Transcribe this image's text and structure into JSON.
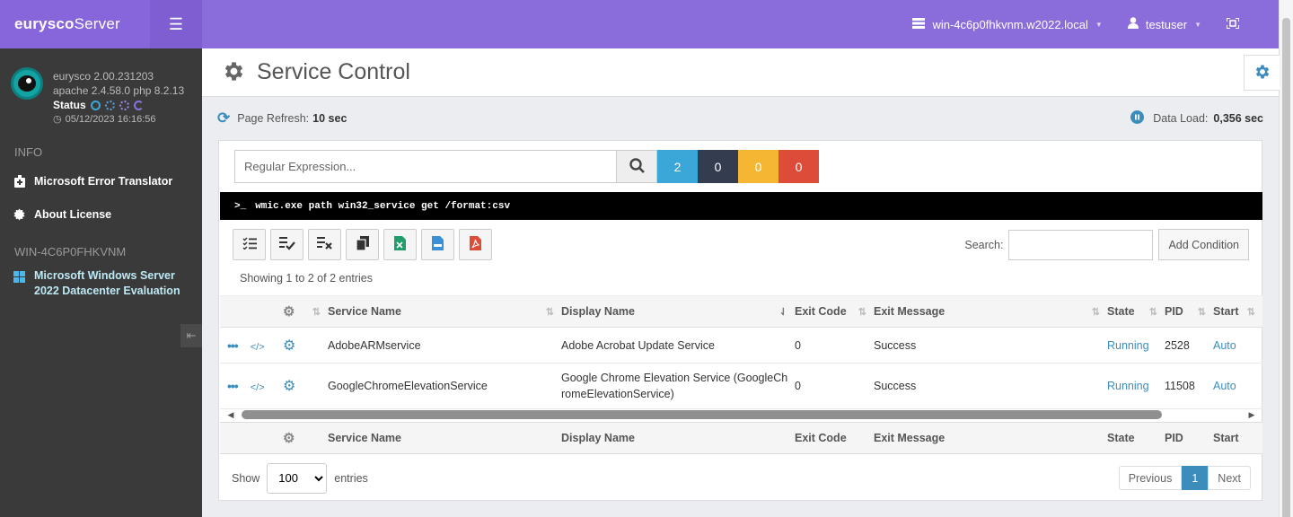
{
  "brand": {
    "name_bold": "eurysco",
    "name_rest": "Server"
  },
  "profile": {
    "version": "eurysco 2.00.231203",
    "stack": "apache 2.4.58.0  php 8.2.13",
    "status_label": "Status",
    "datetime": "05/12/2023 16:16:56"
  },
  "sidebar": {
    "info_title": "INFO",
    "items": [
      {
        "label": "Microsoft Error Translator"
      },
      {
        "label": "About License"
      }
    ],
    "host_title": "WIN-4C6P0FHKVNM",
    "os_line1": "Microsoft  Windows  Server",
    "os_line2": "2022  Datacenter  Evaluation"
  },
  "topbar": {
    "host": "win-4c6p0fhkvnm.w2022.local",
    "user": "testuser"
  },
  "page": {
    "title": "Service Control"
  },
  "info": {
    "refresh_label": "Page Refresh:",
    "refresh_value": "10 sec",
    "load_label": "Data Load:",
    "load_value": "0,356 sec"
  },
  "search": {
    "placeholder": "Regular Expression..."
  },
  "counters": [
    {
      "value": "2",
      "color": "#3aa7d8"
    },
    {
      "value": "0",
      "color": "#343c4f"
    },
    {
      "value": "0",
      "color": "#f5b733"
    },
    {
      "value": "0",
      "color": "#dd4b39"
    }
  ],
  "command": "wmic.exe path win32_service get /format:csv",
  "dt": {
    "search_label": "Search:",
    "add_condition": "Add Condition",
    "info": "Showing 1 to 2 of 2 entries",
    "show_label": "Show",
    "length_value": "100",
    "entries_label": "entries",
    "prev": "Previous",
    "page": "1",
    "next": "Next"
  },
  "columns": [
    "Service Name",
    "Display Name",
    "Exit Code",
    "Exit Message",
    "State",
    "PID",
    "Start"
  ],
  "rows": [
    {
      "service": "AdobeARMservice",
      "display": "Adobe Acrobat Update Service",
      "exit_code": "0",
      "exit_msg": "Success",
      "state": "Running",
      "pid": "2528",
      "start": "Auto"
    },
    {
      "service": "GoogleChromeElevationService",
      "display_l1": "Google Chrome Elevation Service (GoogleCh",
      "display_l2": "romeElevationService)",
      "exit_code": "0",
      "exit_msg": "Success",
      "state": "Running",
      "pid": "11508",
      "start": "Auto"
    }
  ]
}
